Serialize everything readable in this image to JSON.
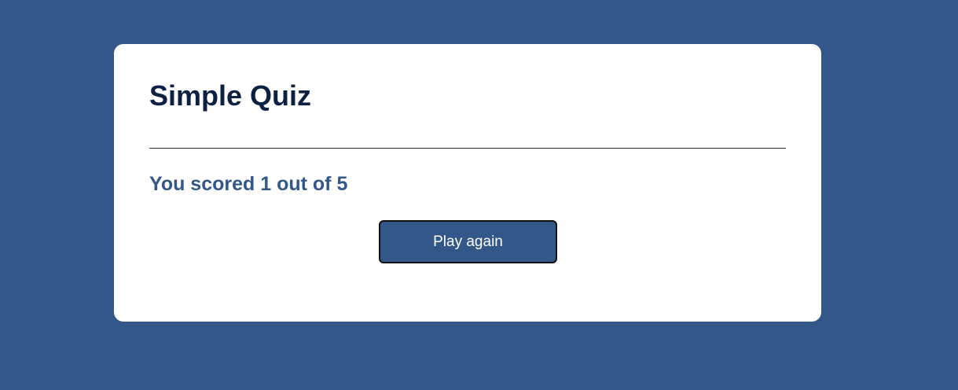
{
  "quiz": {
    "title": "Simple Quiz",
    "score_text": "You scored 1 out of 5",
    "play_again_label": "Play again"
  },
  "colors": {
    "background": "#34578a",
    "card": "#ffffff",
    "title": "#0f2142",
    "score": "#34578a",
    "button_bg": "#34578a",
    "button_text": "#ffffff"
  }
}
